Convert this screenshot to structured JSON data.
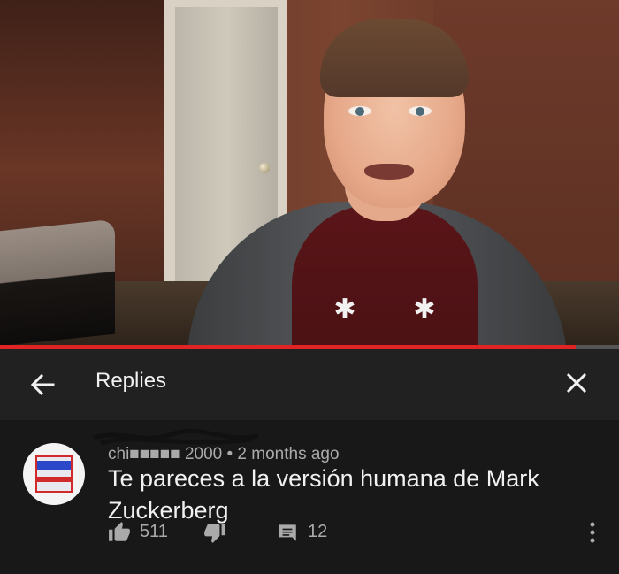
{
  "header": {
    "title": "Replies"
  },
  "video": {
    "progress_fraction": 0.93,
    "progress_color": "#e02424"
  },
  "comment": {
    "meta": "chi■■■■■ 2000 • 2 months ago",
    "text": "Te pareces a la versión humana de Mark Zuckerberg",
    "likes": "511",
    "replies": "12"
  },
  "icons": {
    "back": "arrow-left-icon",
    "close": "close-icon",
    "like": "thumbs-up-icon",
    "dislike": "thumbs-down-icon",
    "reply": "comment-icon",
    "more": "more-vert-icon"
  },
  "colors": {
    "header_bg": "#212121",
    "comment_bg": "#181818",
    "text": "#f1f1f1",
    "secondary_text": "#aaaaaa"
  }
}
